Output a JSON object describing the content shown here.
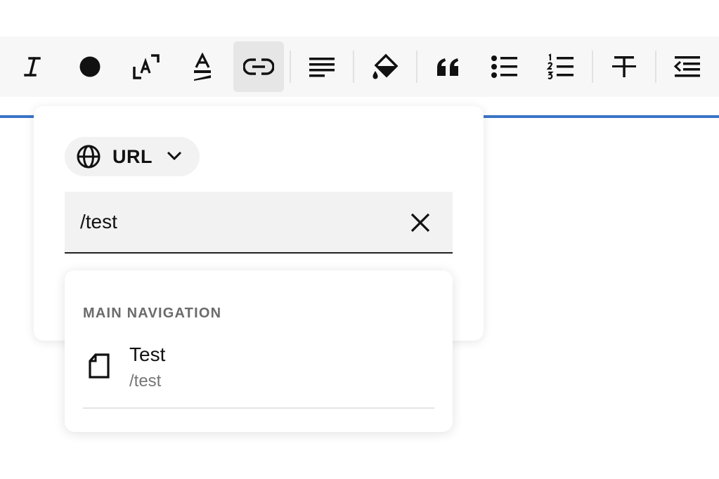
{
  "toolbar": {
    "tools": [
      {
        "name": "italic",
        "icon": "italic-icon"
      },
      {
        "name": "text-color",
        "icon": "color-dot-icon"
      },
      {
        "name": "font-size",
        "icon": "font-size-icon"
      },
      {
        "name": "highlight",
        "icon": "text-highlight-icon"
      },
      {
        "name": "link",
        "icon": "link-icon",
        "active": true
      },
      {
        "name": "align",
        "icon": "align-left-icon"
      },
      {
        "name": "fill",
        "icon": "paint-bucket-icon"
      },
      {
        "name": "quote",
        "icon": "quote-icon"
      },
      {
        "name": "bulleted-list",
        "icon": "bulleted-list-icon"
      },
      {
        "name": "numbered-list",
        "icon": "numbered-list-icon"
      },
      {
        "name": "strikethrough",
        "icon": "strikethrough-icon"
      },
      {
        "name": "outdent",
        "icon": "outdent-icon"
      }
    ],
    "accent_line_color": "#3b74c7"
  },
  "link_popover": {
    "link_type": {
      "label": "URL",
      "icon": "globe-icon",
      "chevron_icon": "chevron-down-icon"
    },
    "url_input": {
      "value": "/test",
      "clear_icon": "close-icon"
    }
  },
  "suggestions": {
    "section_title": "MAIN NAVIGATION",
    "items": [
      {
        "title": "Test",
        "path": "/test",
        "icon": "page-icon"
      }
    ]
  }
}
